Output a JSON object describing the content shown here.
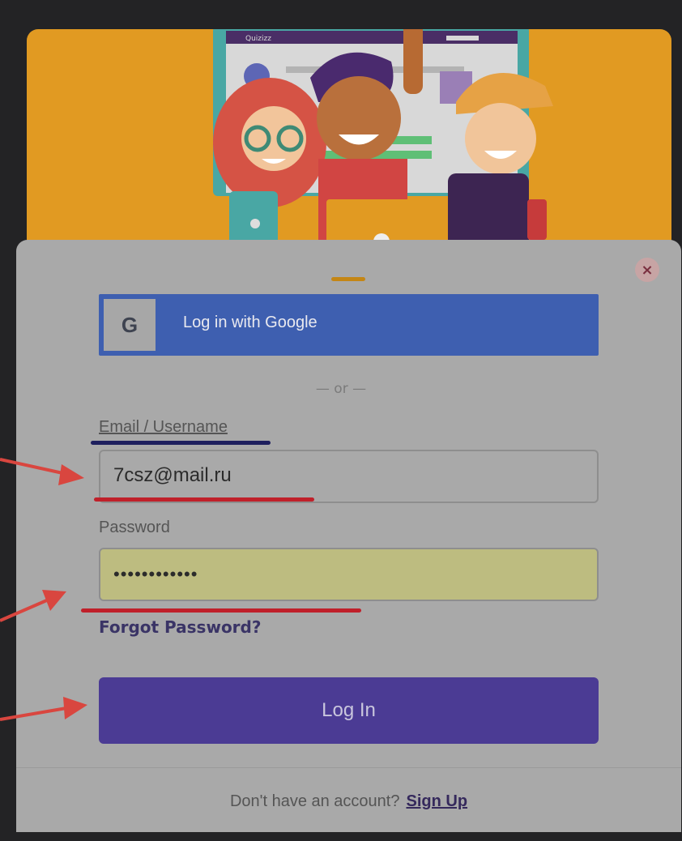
{
  "hero": {
    "brand_text": "Quizizz"
  },
  "modal": {
    "google_button_label": "Log in with Google",
    "google_icon_text": "G",
    "divider_text": "— or —",
    "email_label": "Email / Username",
    "email_value": "7csz@mail.ru",
    "password_label": "Password",
    "password_value": "••••••••••••",
    "forgot_link": "Forgot Password?",
    "login_button": "Log In",
    "footer_prompt": "Don't have an account?",
    "signup_link": "Sign Up"
  },
  "colors": {
    "hero": "#e19a22",
    "google": "#3e5fb0",
    "primary": "#4b3b94",
    "password_fill": "#bdbc80",
    "annotation_red": "#c0202a",
    "annotation_arrow": "#d9463f",
    "annotation_navy": "#1e1f5e"
  },
  "icons": [
    "google-g-icon",
    "close-icon",
    "annotation-arrow-icon"
  ]
}
